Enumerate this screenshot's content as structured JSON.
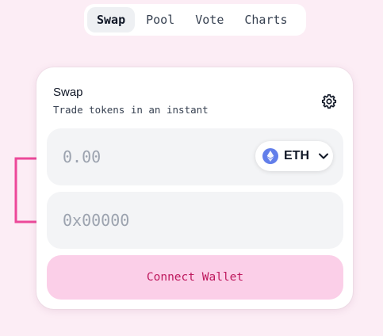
{
  "nav": {
    "tabs": [
      {
        "label": "Swap",
        "active": true
      },
      {
        "label": "Pool",
        "active": false
      },
      {
        "label": "Vote",
        "active": false
      },
      {
        "label": "Charts",
        "active": false
      }
    ]
  },
  "swap_card": {
    "title": "Swap",
    "subtitle": "Trade tokens in an instant",
    "settings_icon": "gear-icon",
    "amount_input": {
      "value": "",
      "placeholder": "0.00"
    },
    "token_selector": {
      "symbol": "ETH",
      "icon": "ethereum-icon"
    },
    "address_input": {
      "value": "",
      "placeholder": "0x00000"
    },
    "connect_button": "Connect Wallet"
  },
  "colors": {
    "background": "#fcedf5",
    "accent": "#ec4899",
    "button_bg": "#fbcfe8",
    "button_text": "#be185d",
    "eth": "#627eea"
  }
}
